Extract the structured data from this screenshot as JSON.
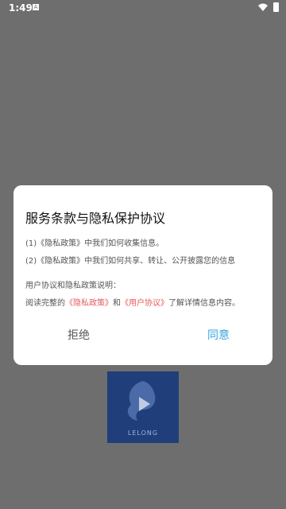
{
  "status": {
    "time": "1:49",
    "a_label": "A"
  },
  "dialog": {
    "title": "服务条款与隐私保护协议",
    "line1": "(1)《隐私政策》中我们如何收集信息。",
    "line2": "(2)《隐私政策》中我们如何共享、转让、公开披露您的信息",
    "line3": "用户协议和隐私政策说明：",
    "line4_prefix": "阅读完整的",
    "privacy_link": "《隐私政策》",
    "line4_and": "和",
    "user_link": "《用户协议》",
    "line4_suffix": "了解详情信息内容。",
    "reject_label": "拒绝",
    "agree_label": "同意"
  },
  "logo": {
    "text": "LELONG"
  }
}
